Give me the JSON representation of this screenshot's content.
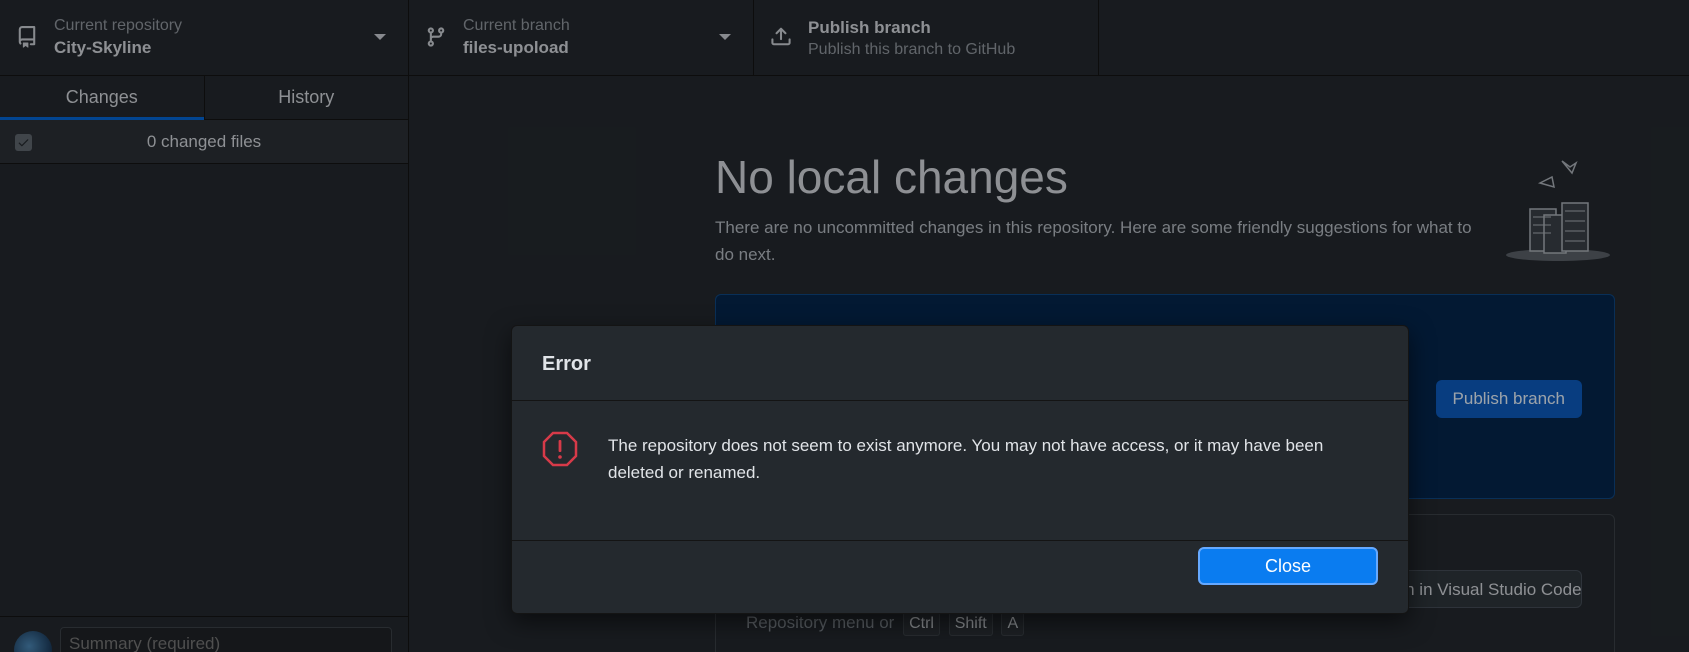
{
  "toolbar": {
    "repository": {
      "label": "Current repository",
      "value": "City-Skyline",
      "icon": "repo-icon"
    },
    "branch": {
      "label": "Current branch",
      "value": "files-upoload",
      "icon": "git-branch-icon"
    },
    "publish": {
      "label": "Publish branch",
      "value": "Publish this branch to GitHub",
      "icon": "upload-icon"
    }
  },
  "sidebar": {
    "tabs": [
      {
        "label": "Changes",
        "selected": true
      },
      {
        "label": "History",
        "selected": false
      }
    ],
    "changed_files": "0 changed files",
    "summary_placeholder": "Summary (required)"
  },
  "main": {
    "title": "No local changes",
    "description": "There are no uncommitted changes in this repository. Here are some friendly suggestions for what to do next.",
    "publish_button": "Publish branch",
    "open_editor_button": "Open in Visual Studio Code",
    "repo_menu_hint": "Repository menu or",
    "shortcut_keys": [
      "Ctrl",
      "Shift",
      "A"
    ]
  },
  "dialog": {
    "title": "Error",
    "message": "The repository does not seem to exist anymore. You may not have access, or it may have been deleted or renamed.",
    "close_label": "Close",
    "icon": "stop-error-icon"
  },
  "colors": {
    "background": "#24292e",
    "accent": "#0a7cf0",
    "publish_card": "#05264c",
    "error": "#d73a49"
  }
}
